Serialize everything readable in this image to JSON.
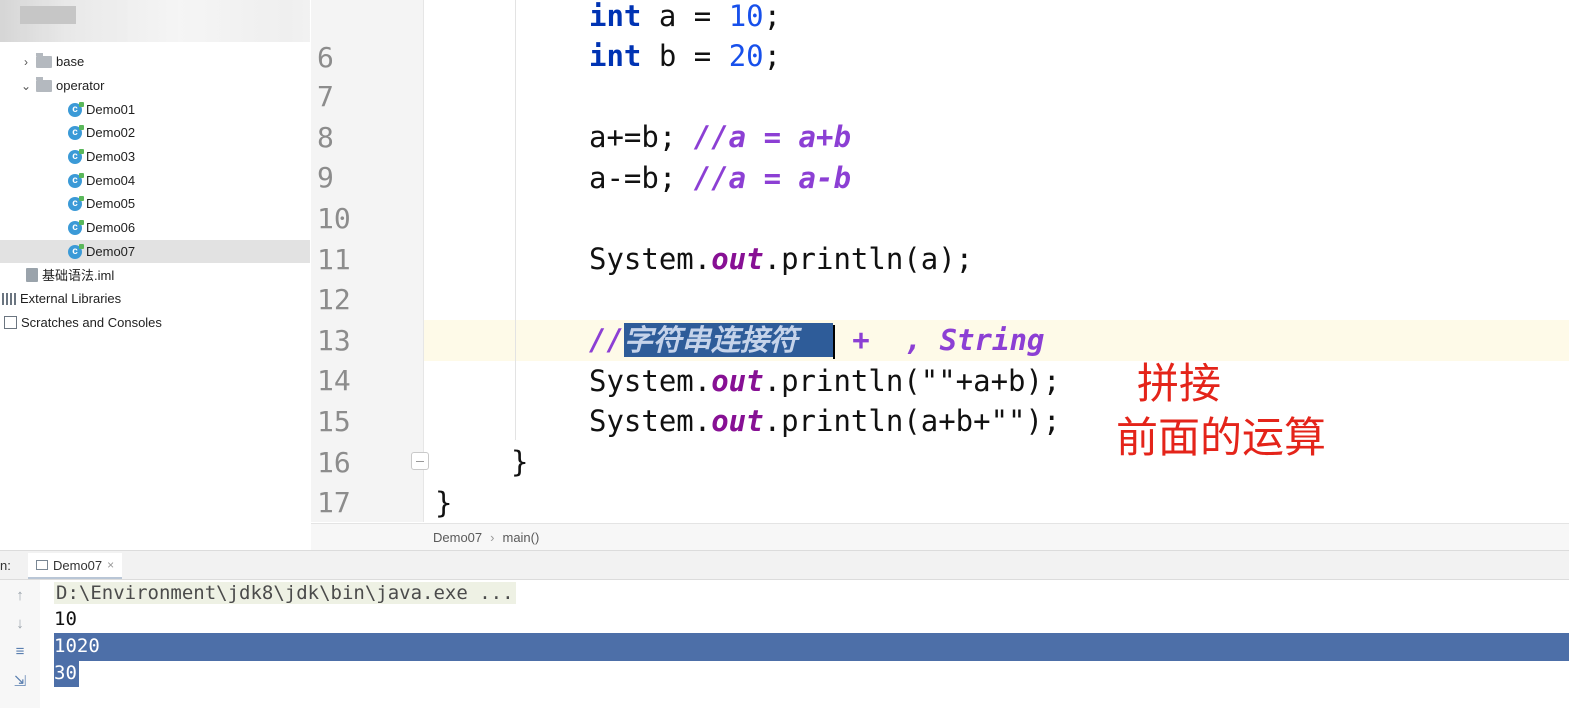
{
  "sidebar": {
    "items": [
      {
        "label": "base",
        "kind": "folder",
        "expanded": false
      },
      {
        "label": "operator",
        "kind": "folder",
        "expanded": true
      },
      {
        "label": "Demo01",
        "kind": "class"
      },
      {
        "label": "Demo02",
        "kind": "class"
      },
      {
        "label": "Demo03",
        "kind": "class"
      },
      {
        "label": "Demo04",
        "kind": "class"
      },
      {
        "label": "Demo05",
        "kind": "class"
      },
      {
        "label": "Demo06",
        "kind": "class"
      },
      {
        "label": "Demo07",
        "kind": "class",
        "selected": true
      },
      {
        "label": "基础语法.iml",
        "kind": "iml"
      },
      {
        "label": "External Libraries",
        "kind": "libraries"
      },
      {
        "label": "Scratches and Consoles",
        "kind": "scratches"
      }
    ],
    "class_icon_letter": "c"
  },
  "editor": {
    "line_numbers": [
      "6",
      "7",
      "8",
      "9",
      "10",
      "11",
      "12",
      "13",
      "14",
      "15",
      "16",
      "17"
    ],
    "current_line": "13",
    "code": {
      "l5_kw": "int",
      "l5_rest": " a = ",
      "l5_num": "10",
      "l5_end": ";",
      "l6_kw": "int",
      "l6_rest": " b = ",
      "l6_num": "20",
      "l6_end": ";",
      "l8_code": "a+=b; ",
      "l8_comment": "//a = a+b",
      "l9_code": "a-=b; ",
      "l9_comment": "//a = a-b",
      "l11_pre": "System.",
      "l11_field": "out",
      "l11_post": ".println(a);",
      "l13_slashes": "//",
      "l13_selected": "字符串连接符  ",
      "l13_rest": " +  , String",
      "l14_pre": "System.",
      "l14_field": "out",
      "l14_post": ".println(\"\"+a+b);",
      "l15_pre": "System.",
      "l15_field": "out",
      "l15_post": ".println(a+b+\"\");",
      "l16_code": "}",
      "l17_code": "}"
    }
  },
  "annotations": {
    "line1": "拼接",
    "line2": "前面的运算",
    "color": "#e4241a"
  },
  "breadcrumb": {
    "items": [
      "Demo07",
      "main()"
    ],
    "separator": "›"
  },
  "run_panel": {
    "prefix": "n:",
    "tab_label": "Demo07",
    "tab_close": "×",
    "output": [
      {
        "text": "D:\\Environment\\jdk8\\jdk\\bin\\java.exe ...",
        "selected": false
      },
      {
        "text": "10",
        "selected": false
      },
      {
        "text": "1020",
        "selected": true
      },
      {
        "text": "30",
        "selected": true
      }
    ]
  },
  "colors": {
    "keyword": "#0033b3",
    "number": "#1750eb",
    "comment": "#8c3fd4",
    "selection": "#2e5c99",
    "console_selection": "#4d6fa8"
  }
}
